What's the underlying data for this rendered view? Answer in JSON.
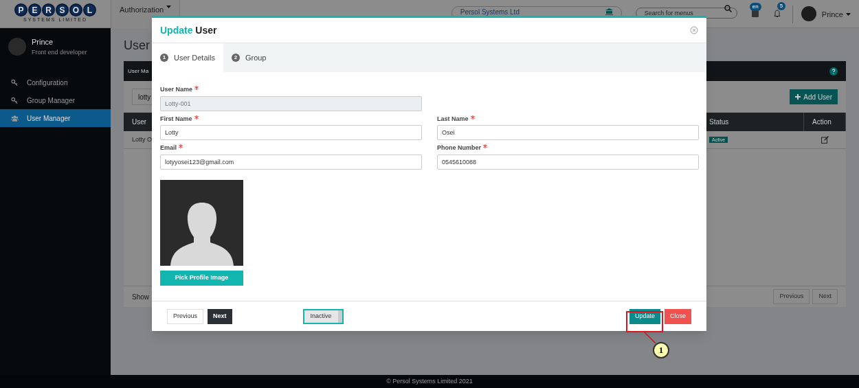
{
  "logo": {
    "letters": [
      "P",
      "E",
      "R",
      "S",
      "O",
      "L"
    ],
    "subtitle": "SYSTEMS LIMITED"
  },
  "topbar": {
    "menu": "Authorization",
    "company": "Persol Systems Ltd",
    "search": {
      "placeholder": "Search for menus"
    },
    "language_badge": "en",
    "notification_badge": "5",
    "user": "Prince"
  },
  "sidebar": {
    "user": {
      "name": "Prince",
      "role": "Front end developer"
    },
    "items": [
      {
        "label": "Configuration",
        "kind": "key",
        "selected": false
      },
      {
        "label": "Group Manager",
        "kind": "key",
        "selected": false
      },
      {
        "label": "User Manager",
        "kind": "users",
        "selected": true
      }
    ]
  },
  "page": {
    "title": "User",
    "panel_title": "User Ma",
    "search_value": "lotty",
    "add_button": "Add User",
    "columns": [
      "User",
      "Status",
      "Action"
    ],
    "rows": [
      {
        "user": "Lotty O",
        "status": "Active"
      }
    ],
    "show_label": "Show",
    "pagination": [
      "Previous",
      "Next"
    ]
  },
  "modal": {
    "title_accent": "Update",
    "title": "User",
    "steps": [
      {
        "number": "1",
        "label": "User Details",
        "selected": true
      },
      {
        "number": "2",
        "label": "Group",
        "selected": false
      }
    ],
    "field_rows": [
      [
        {
          "label": "User Name",
          "required": true,
          "value": "Lotty-001",
          "disabled": true
        }
      ],
      [
        {
          "label": "First Name",
          "required": true,
          "value": "Lotty",
          "disabled": false
        },
        {
          "label": "Last Name",
          "required": true,
          "value": "Osei",
          "disabled": false
        }
      ],
      [
        {
          "label": "Email",
          "required": true,
          "value": "lotyyosei123@gmail.com",
          "disabled": false
        },
        {
          "label": "Phone Number",
          "required": true,
          "value": "0545610088",
          "disabled": false
        }
      ]
    ],
    "pick_image_button": "Pick Profile Image",
    "footer": {
      "previous": "Previous",
      "next": "Next",
      "status_toggle": {
        "label": "Inactive",
        "on": false
      },
      "update": "Update",
      "close": "Close"
    }
  },
  "annotation": {
    "number": "1"
  },
  "footer": "© Persol Systems Limited 2021"
}
